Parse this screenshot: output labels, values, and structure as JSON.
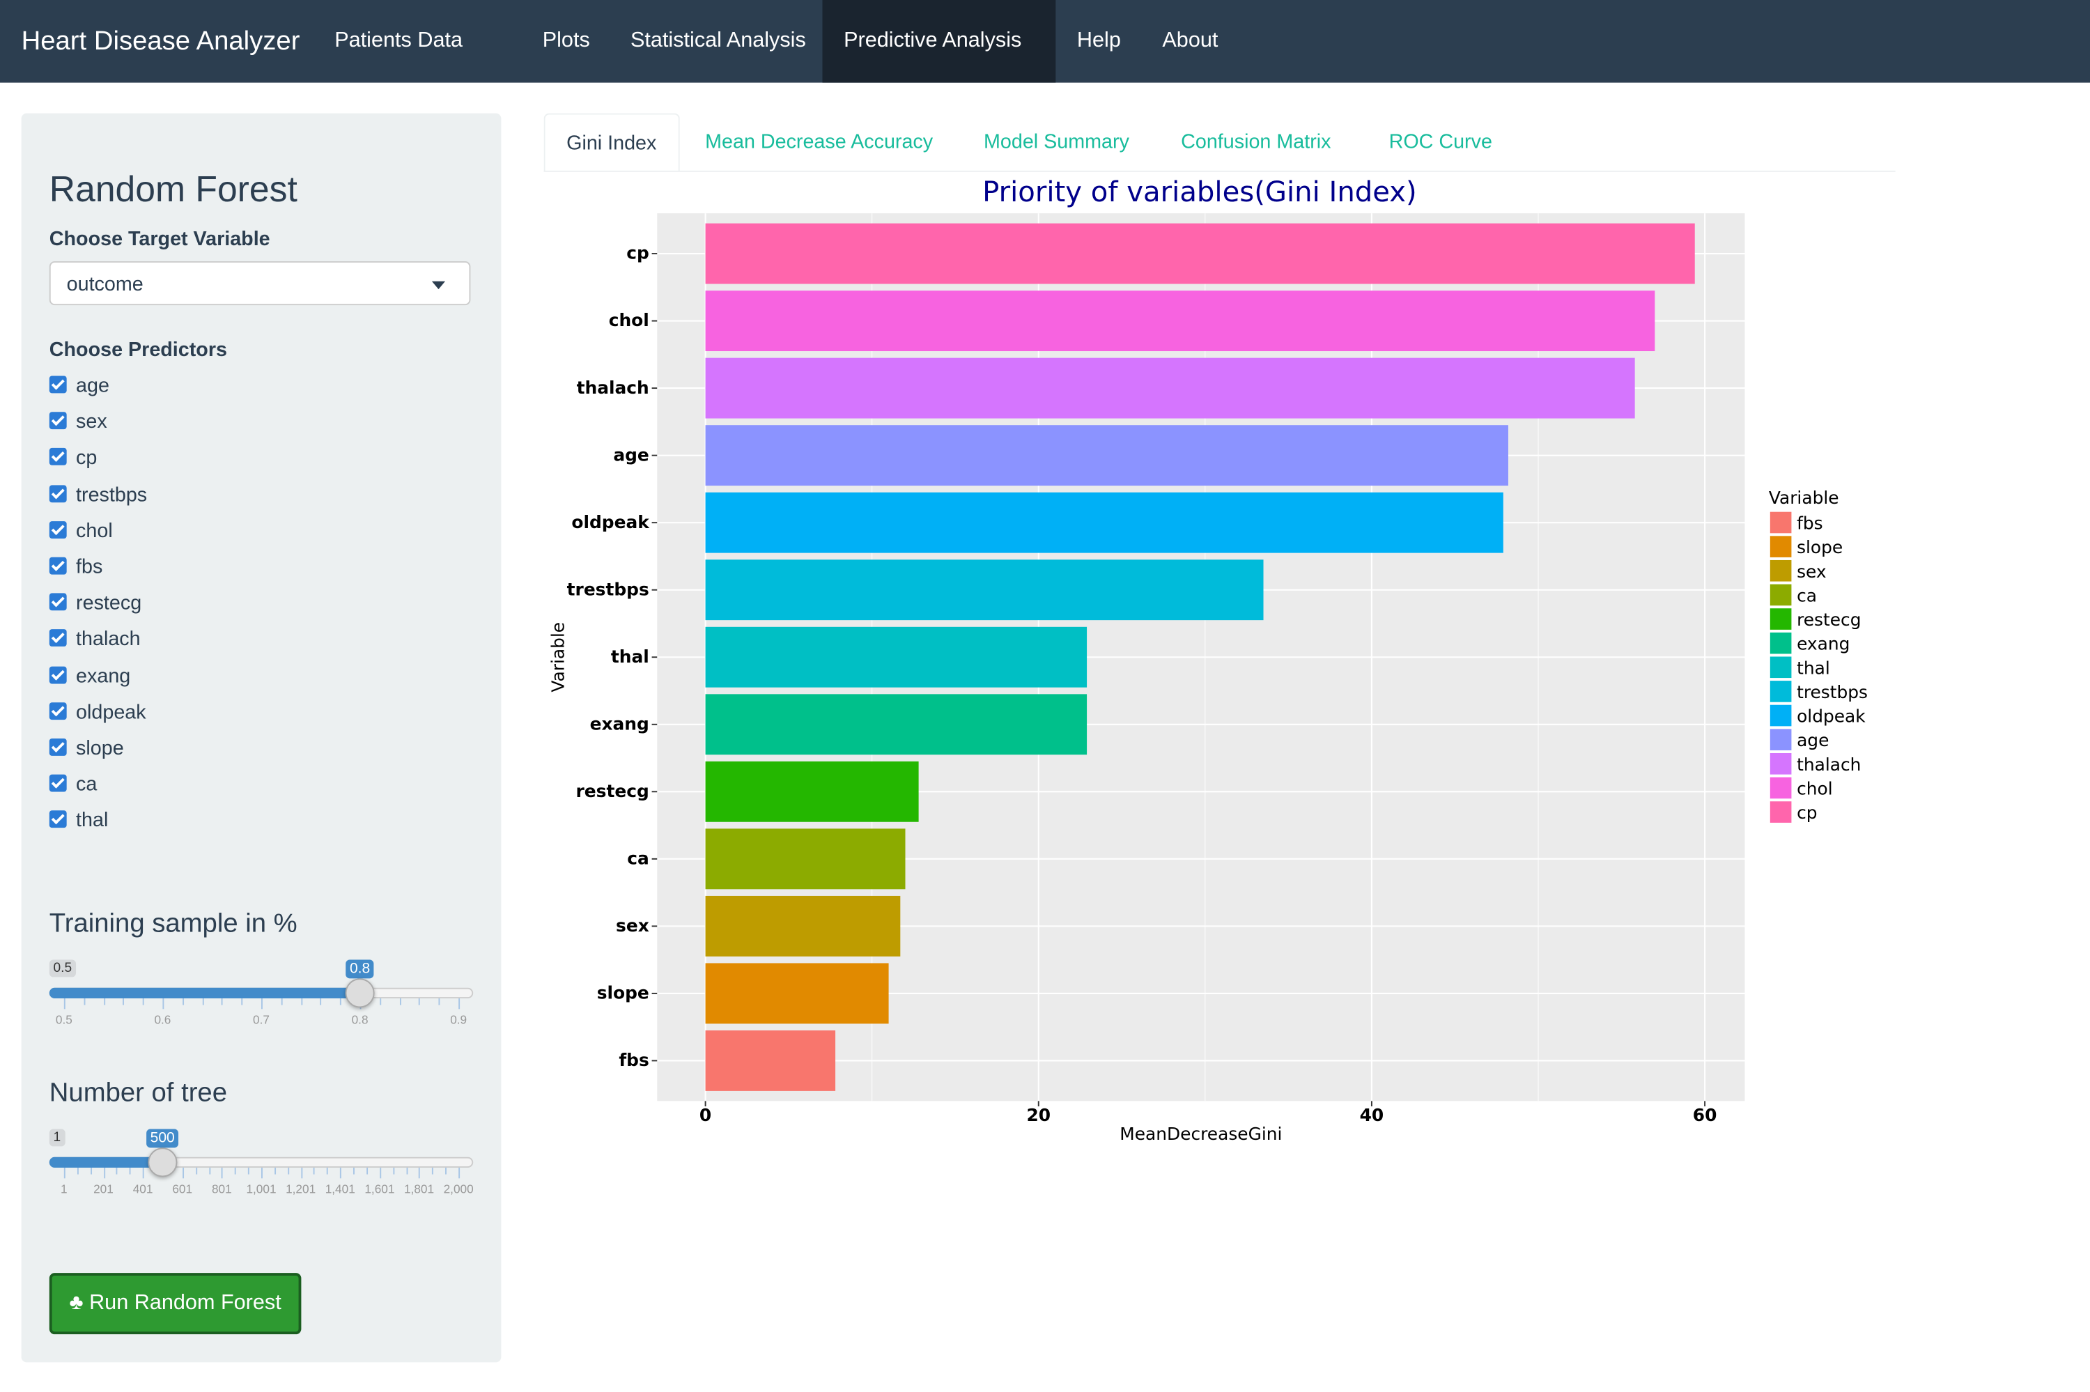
{
  "navbar": {
    "brand": "Heart Disease Analyzer",
    "items": [
      "Patients Data",
      "Plots",
      "Statistical Analysis",
      "Predictive Analysis",
      "Help",
      "About"
    ],
    "active": "Predictive Analysis"
  },
  "sidebar": {
    "title": "Random Forest",
    "target_label": "Choose Target Variable",
    "target_value": "outcome",
    "predictors_label": "Choose Predictors",
    "predictors": [
      "age",
      "sex",
      "cp",
      "trestbps",
      "chol",
      "fbs",
      "restecg",
      "thalach",
      "exang",
      "oldpeak",
      "slope",
      "ca",
      "thal"
    ],
    "training": {
      "label": "Training sample in %",
      "min": "0.5",
      "max": "0.9",
      "value": 0.8,
      "value_label": "0.8",
      "ticks": [
        "0.5",
        "0.6",
        "0.7",
        "0.8",
        "0.9"
      ]
    },
    "trees": {
      "label": "Number of tree",
      "min": "1",
      "max": "2,000",
      "value": 500,
      "value_label": "500",
      "ticks": [
        "1",
        "201",
        "401",
        "601",
        "801",
        "1,001",
        "1,201",
        "1,401",
        "1,601",
        "1,801",
        "2,000"
      ]
    },
    "run_button": "Run Random Forest",
    "run_icon": "tree-icon",
    "accent": "#428bca"
  },
  "tabs": [
    "Gini Index",
    "Mean Decrease Accuracy",
    "Model Summary",
    "Confusion Matrix",
    "ROC Curve"
  ],
  "active_tab": "Gini Index",
  "chart_data": {
    "type": "bar",
    "orientation": "horizontal",
    "title": "Priority of variables(Gini Index)",
    "xlabel": "MeanDecreaseGini",
    "ylabel": "Variable",
    "categories": [
      "cp",
      "chol",
      "thalach",
      "age",
      "oldpeak",
      "trestbps",
      "thal",
      "exang",
      "restecg",
      "ca",
      "sex",
      "slope",
      "fbs"
    ],
    "values": [
      59.4,
      57.0,
      55.8,
      48.2,
      47.9,
      33.5,
      22.9,
      22.9,
      12.8,
      12.0,
      11.7,
      11.0,
      7.8
    ],
    "colors": [
      "#FF65AC",
      "#F763E0",
      "#D575FE",
      "#8B93FF",
      "#00B0F6",
      "#00BBDA",
      "#00BFC4",
      "#00C08B",
      "#24B700",
      "#8CAB00",
      "#BE9C00",
      "#E18A00",
      "#F8766D"
    ],
    "xlim": [
      -2.9,
      62.4
    ],
    "xticks": [
      "0",
      "20",
      "40",
      "60"
    ],
    "grid": true,
    "legend": {
      "title": "Variable",
      "position": "right",
      "entries": [
        "fbs",
        "slope",
        "sex",
        "ca",
        "restecg",
        "exang",
        "thal",
        "trestbps",
        "oldpeak",
        "age",
        "thalach",
        "chol",
        "cp"
      ]
    }
  }
}
